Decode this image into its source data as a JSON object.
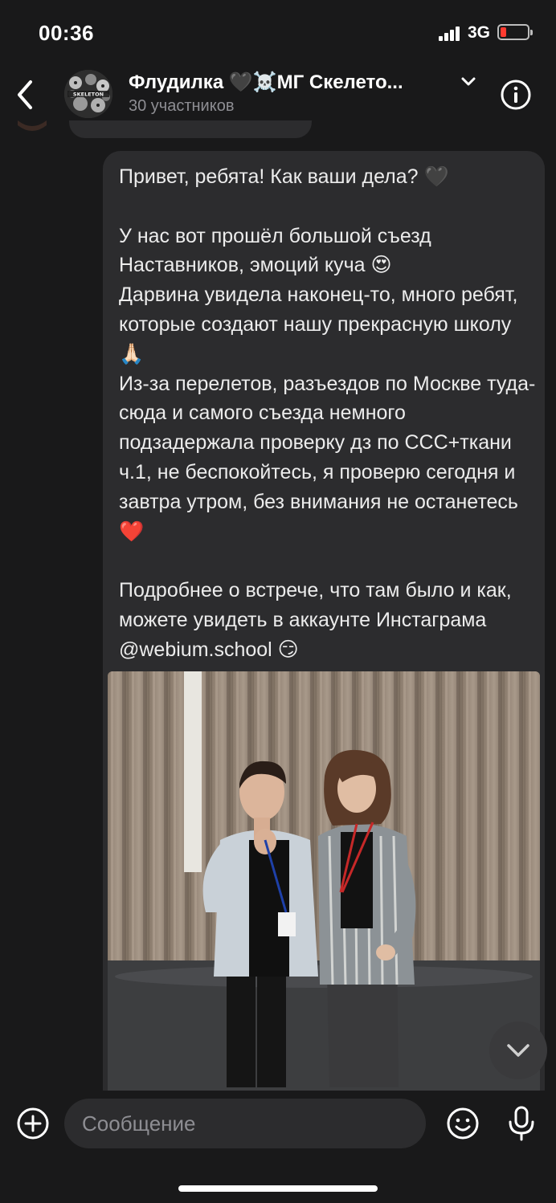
{
  "status": {
    "time": "00:36",
    "network": "3G"
  },
  "header": {
    "title": "Флудилка 🖤☠️МГ Скелето...",
    "subtitle": "30 участников",
    "avatar_text": "SKELETON"
  },
  "message": {
    "text": "Привет, ребята! Как ваши дела? 🖤\n\nУ нас вот прошёл большой съезд Наставников, эмоций куча 😍\nДарвина увидела наконец-то, много ребят, которые создают нашу прекрасную школу 🙏🏻\nИз-за перелетов, разъездов по Москве туда-сюда и самого съезда немного подзадержала проверку дз по ССС+ткани ч.1, не беспокойтесь, я проверю сегодня и завтра утром, без внимания не останетесь ❤️\n\nПодробнее о встрече, что там было и как, можете увидеть в аккаунте Инстаграма @webium.school 😏"
  },
  "composer": {
    "placeholder": "Сообщение"
  },
  "colors": {
    "background": "#19191a",
    "bubble": "#2c2c2e",
    "accent": "#ff3b30"
  },
  "icons": [
    "back-icon",
    "chevron-down-icon",
    "info-icon",
    "plus-icon",
    "emoji-icon",
    "microphone-icon",
    "battery-icon",
    "signal-icon"
  ]
}
